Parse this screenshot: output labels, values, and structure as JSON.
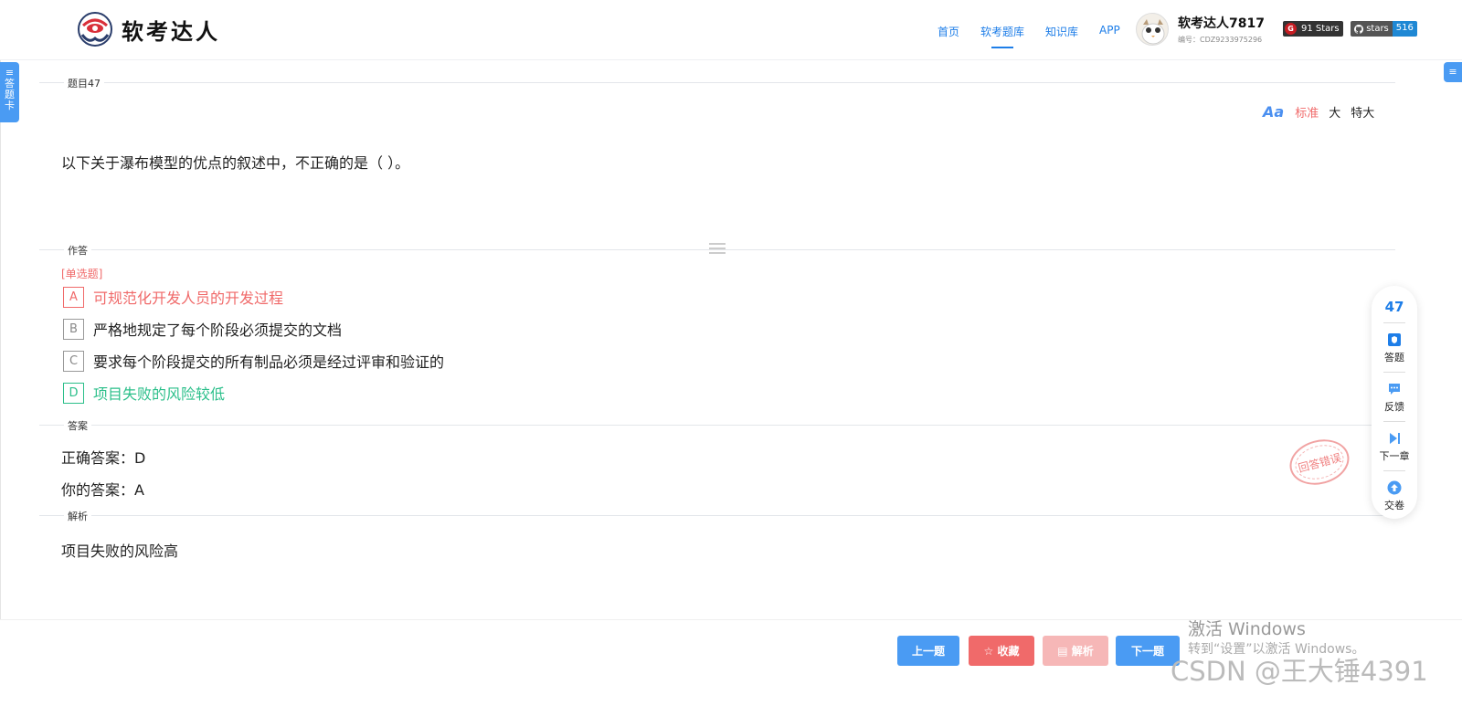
{
  "header": {
    "logo_text": "软考达人",
    "nav": [
      "首页",
      "软考题库",
      "知识库",
      "APP"
    ],
    "active_nav": 1,
    "user_name": "软考达人7817",
    "user_id": "编号：CDZ9233975296",
    "gitee_badge": "91 Stars",
    "github_label": "stars",
    "github_count": "516"
  },
  "side_tab": {
    "icon": "menu-icon",
    "label": "答题卡"
  },
  "question": {
    "section_label": "题目47",
    "font_sizes": [
      "标准",
      "大",
      "特大"
    ],
    "text": "以下关于瀑布模型的优点的叙述中，不正确的是（ ）。"
  },
  "answer_section": {
    "label": "作答",
    "type": "[单选题]",
    "options": [
      {
        "key": "A",
        "text": "可规范化开发人员的开发过程",
        "state": "wrong"
      },
      {
        "key": "B",
        "text": "严格地规定了每个阶段必须提交的文档",
        "state": "normal"
      },
      {
        "key": "C",
        "text": "要求每个阶段提交的所有制品必须是经过评审和验证的",
        "state": "normal"
      },
      {
        "key": "D",
        "text": "项目失败的风险较低",
        "state": "right"
      }
    ]
  },
  "result": {
    "label": "答案",
    "correct": "正确答案：D",
    "yours": "你的答案：A",
    "stamp": "回答错误"
  },
  "analysis": {
    "label": "解析",
    "text": "项目失败的风险高"
  },
  "float_panel": {
    "number": "47",
    "items": [
      {
        "label": "答题",
        "icon": "shield-icon"
      },
      {
        "label": "反馈",
        "icon": "chat-icon"
      },
      {
        "label": "下一章",
        "icon": "next-icon"
      },
      {
        "label": "交卷",
        "icon": "upload-icon"
      }
    ]
  },
  "buttons": {
    "prev": "上一题",
    "fav": "收藏",
    "analysis": "解析",
    "next": "下一题"
  },
  "watermark": {
    "line1": "激活 Windows",
    "line2": "转到“设置”以激活 Windows。",
    "csdn": "CSDN @王大锤4391"
  },
  "colors": {
    "accent": "#4a9bf3",
    "wrong": "#f06a6a",
    "right": "#2bbf8a"
  }
}
